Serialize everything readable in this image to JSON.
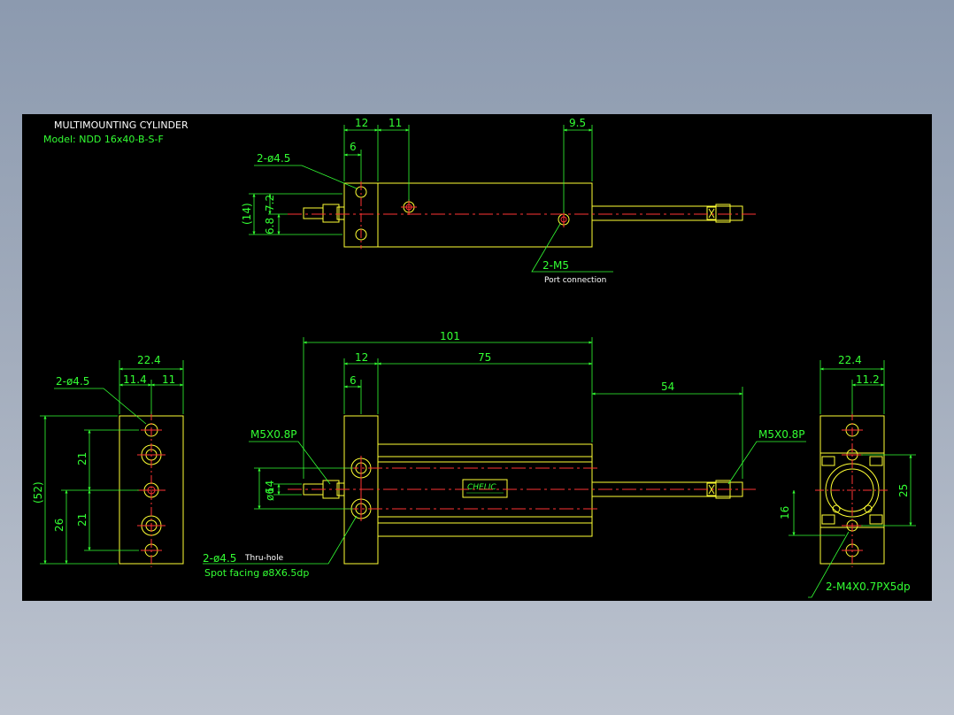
{
  "title_block": {
    "title": "MULTIMOUNTING CYLINDER",
    "model": "Model:  NDD 16x40-B-S-F"
  },
  "top_view": {
    "dim_12": "12",
    "dim_11": "11",
    "dim_9_5": "9.5",
    "dim_6": "6",
    "hole_callout": "2-ø4.5",
    "dim_14_paren": "(14)",
    "dim_6_8": "6.8",
    "dim_7_2": "7.2",
    "port_callout": "2-M5",
    "port_note": "Port connection"
  },
  "front_view": {
    "dim_101": "101",
    "dim_12": "12",
    "dim_75": "75",
    "dim_6": "6",
    "dim_54": "54",
    "port_left": "M5X0.8P",
    "port_right": "M5X0.8P",
    "dim_14": "14",
    "dim_phi6": "ø6",
    "hole_callout": "2-ø4.5",
    "thru_note": "Thru-hole",
    "spot_facing": "Spot facing  ø8X6.5dp",
    "logo": "CHELIC"
  },
  "side_view": {
    "dim_22_4": "22.4",
    "hole_callout": "2-ø4.5",
    "dim_11_4": "11.4",
    "dim_11": "11",
    "dim_52_paren": "(52)",
    "dim_21_a": "21",
    "dim_21_b": "21",
    "dim_26": "26"
  },
  "end_view": {
    "dim_22_4": "22.4",
    "dim_11_2": "11.2",
    "dim_25": "25",
    "dim_16": "16",
    "thread_callout": "2-M4X0.7PX5dp"
  }
}
